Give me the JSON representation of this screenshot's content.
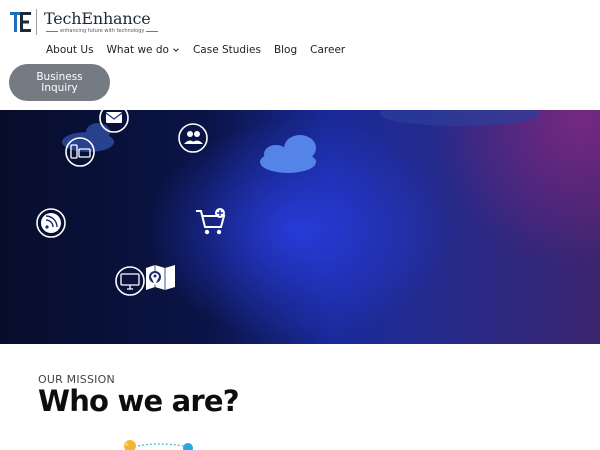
{
  "brand": {
    "name": "TechEnhance",
    "tagline": "enhancing future with technology",
    "logo_icon": "te-monogram-icon",
    "colors": {
      "logo_blue": "#1e6fb8",
      "logo_navy": "#1b2a3a"
    }
  },
  "nav": {
    "items": [
      {
        "label": "About Us"
      },
      {
        "label": "What we do",
        "icon": "chevron-down-icon"
      },
      {
        "label": "Case Studies"
      },
      {
        "label": "Blog"
      },
      {
        "label": "Career"
      }
    ]
  },
  "cta": {
    "label": "Business Inquiry",
    "color": "#757b82"
  },
  "hero": {
    "icons": [
      "mail-icon",
      "users-icon",
      "devices-icon",
      "rss-icon",
      "cart-add-icon",
      "monitor-icon",
      "map-pin-icon",
      "cloud-icon"
    ],
    "colors": {
      "dark": "#070d2a",
      "blue": "#1a2a9a",
      "purple": "#3a246e"
    }
  },
  "mission": {
    "eyebrow": "OUR MISSION",
    "title": "Who we are?"
  }
}
